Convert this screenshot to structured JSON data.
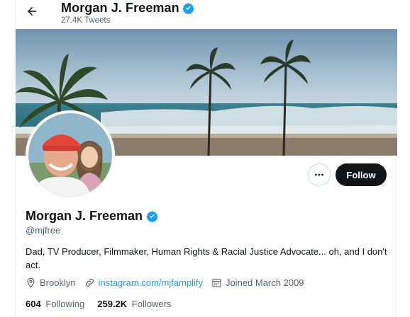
{
  "header": {
    "name": "Morgan J. Freeman",
    "tweet_count": "27.4K Tweets"
  },
  "icons": {
    "back": "arrow-left-icon",
    "verified": "verified-badge-icon",
    "more": "more-horizontal-icon",
    "location": "location-pin-icon",
    "link": "link-icon",
    "calendar": "calendar-icon"
  },
  "profile": {
    "name": "Morgan J. Freeman",
    "handle": "@mjfree",
    "bio": "Dad, TV Producer, Filmmaker, Human Rights & Racial Justice Advocate... oh, and I don't act.",
    "location": "Brooklyn",
    "website": "instagram.com/mjfamplify",
    "joined": "Joined March 2009",
    "following_count": "604",
    "following_label": "Following",
    "followers_count": "259.2K",
    "followers_label": "Followers"
  },
  "actions": {
    "follow_label": "Follow"
  },
  "colors": {
    "accent": "#1d9bf0",
    "text": "#0f1419",
    "secondary": "#536471",
    "follow_bg": "#0f1419"
  }
}
